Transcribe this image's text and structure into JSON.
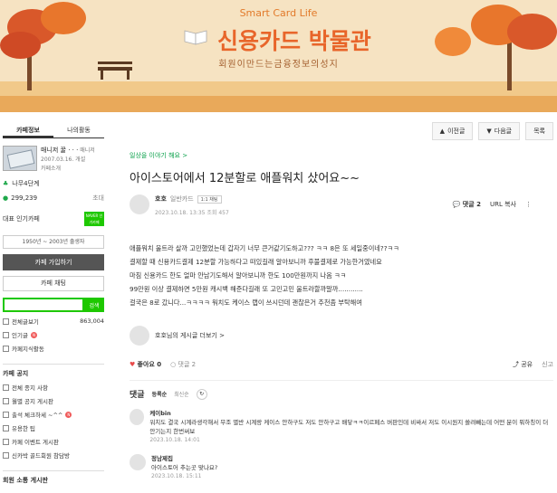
{
  "banner": {
    "brand": "Smart Card Life",
    "title": "신용카드 박물관",
    "subtitle": "회원이만드는금융정보의성지"
  },
  "nav": {
    "prev": "이전글",
    "next": "다음글",
    "list": "목록"
  },
  "sidebar": {
    "tabs": [
      "카페정보",
      "나의활동"
    ],
    "manager_name": "매니저 꿀 · · ·",
    "manager_role": "매니저",
    "since": "2007.03.16. 개설",
    "intro": "카페소개",
    "grade": "나무4단계",
    "members": "299,239",
    "invite": "초대",
    "popular_label": "대표 인기카페",
    "badge": "NAVER 인기카페",
    "period": "1950년 ~ 2003년 출생자",
    "join": "카페 가입하기",
    "chat": "카페 채팅",
    "search_button": "검색",
    "stats": [
      {
        "label": "전체글보기",
        "value": "863,004"
      },
      {
        "label": "인기글",
        "value": ""
      },
      {
        "label": "카페지식활동",
        "value": ""
      }
    ],
    "notice_header": "카페 공지",
    "menu": [
      "전체 종지 사항",
      "월별 공지 게시판",
      "출석 체크하세 ~^^",
      "유용한 팁",
      "카페 이벤트 게시판",
      "신카박 골드회원 참담방"
    ],
    "community_header": "회원 소통 게시판"
  },
  "article": {
    "board": "일상을 이야기 해요 >",
    "title": "아이스토어에서 12분할로 애플워치 샀어요~~",
    "author": "호호",
    "rank": "일반카드",
    "badge": "1:1 채팅",
    "date": "2023.10.18. 13:35",
    "views": "조회 457",
    "comment_count": "댓글 2",
    "url_copy": "URL 복사",
    "body": [
      "애플워치 울트라 살까 고민했었는데 갑자기 너무 큰거같기도하고??? ㅋㅋ 8은 또 세일중이네??ㅋㅋ",
      "결제할 때 신용카드결제 12분할 가능하다고 떠있길래 알아보니까 후불결제로 가능한거였네요",
      "마침 신용카드 한도 얼마 안남기도해서 알아보니까 한도 100만원까지 나옴 ㅋㅋ",
      "99만원 이상 결제하면 5만원 캐시백 해준다길래 또 고민고민 울트라할까말까............",
      "걸국은 8로 갔니다...ㅋㅋㅋㅋ 워치도 케이스 랩이 쓰시던데 괜찮은거 추천좀 부탁해여"
    ],
    "author_posts": "호호님의 게시글 더보기 >",
    "likes": "좋아요 0",
    "comments_short": "댓글 2",
    "share": "공유",
    "report": "신고"
  },
  "comments": {
    "header": "댓글",
    "sort_active": "등록순",
    "sort_other": "최신순",
    "items": [
      {
        "name": "케이bin",
        "text": "워치도 결국 시계라생각해서 무조 별반 시계랑 케이스 안하구도 저도 안하구고 배닿ㅋㅋ이르페스 버판인데 비싸서 저도 이시원지 쓸려빼는데 어떤 분이 뭐하칭이 더 안기는지 한번써보",
        "date": "2023.10.18. 14:01"
      },
      {
        "name": "정남제집",
        "text": "아이스토어 추는곳 맞나요?",
        "date": "2023.10.18. 15:11"
      }
    ]
  },
  "colors": {
    "accent": "#1ec800",
    "banner_title": "#e8652a",
    "banner_bg": "#f6e3c2"
  }
}
